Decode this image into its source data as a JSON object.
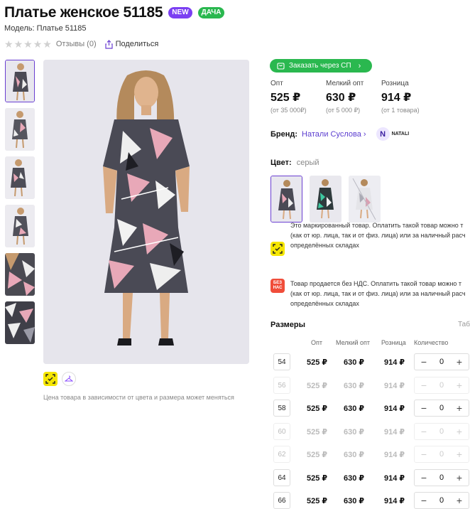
{
  "product": {
    "title": "Платье женское 51185",
    "badges": [
      {
        "label": "NEW",
        "color": "#7b3ff2"
      },
      {
        "label": "ДАЧА",
        "color": "#2ab84f"
      }
    ],
    "model": "Модель: Платье 51185",
    "reviews": "Отзывы (0)",
    "share": "Поделиться",
    "rating_stars": 0
  },
  "order_button": "Заказать через СП",
  "prices": [
    {
      "label": "Опт",
      "value": "525 ₽",
      "sub": "(от 35 000₽)"
    },
    {
      "label": "Мелкий опт",
      "value": "630 ₽",
      "sub": "(от 5 000 ₽)"
    },
    {
      "label": "Розница",
      "value": "914 ₽",
      "sub": "(от 1 товара)"
    }
  ],
  "brand": {
    "label": "Бренд:",
    "name": "Натали Суслова",
    "logo_text": "NATALI"
  },
  "color": {
    "label": "Цвет:",
    "value": "серый"
  },
  "info": [
    {
      "icon": "marking-icon",
      "lines": [
        "Это маркированный товар. Оплатить такой товар можно т",
        "(как от юр. лица, так и от физ. лица) или за наличный расч",
        "определённых складах"
      ]
    },
    {
      "icon": "no-vat-icon",
      "icon_text": "БЕЗ НАС",
      "lines": [
        "Товар продается без НДС. Оплатить такой товар можно т",
        "(как от юр. лица, так и от физ. лица) или за наличный расч",
        "определённых складах"
      ]
    }
  ],
  "price_note": "Цена товара в зависимости от цвета и размера может меняться",
  "sizes": {
    "title": "Размеры",
    "table_link": "Табл",
    "columns": [
      "Опт",
      "Мелкий опт",
      "Розница",
      "Количество"
    ],
    "rows": [
      {
        "size": "54",
        "opt": "525 ₽",
        "small": "630 ₽",
        "retail": "914 ₽",
        "qty": "0",
        "available": true
      },
      {
        "size": "56",
        "opt": "525 ₽",
        "small": "630 ₽",
        "retail": "914 ₽",
        "qty": "0",
        "available": false
      },
      {
        "size": "58",
        "opt": "525 ₽",
        "small": "630 ₽",
        "retail": "914 ₽",
        "qty": "0",
        "available": true
      },
      {
        "size": "60",
        "opt": "525 ₽",
        "small": "630 ₽",
        "retail": "914 ₽",
        "qty": "0",
        "available": false
      },
      {
        "size": "62",
        "opt": "525 ₽",
        "small": "630 ₽",
        "retail": "914 ₽",
        "qty": "0",
        "available": false
      },
      {
        "size": "64",
        "opt": "525 ₽",
        "small": "630 ₽",
        "retail": "914 ₽",
        "qty": "0",
        "available": true
      },
      {
        "size": "66",
        "opt": "525 ₽",
        "small": "630 ₽",
        "retail": "914 ₽",
        "qty": "0",
        "available": true
      }
    ]
  },
  "colors": {
    "accent": "#6a3fd1",
    "green": "#2ab84f",
    "link": "#5b3dcf"
  }
}
